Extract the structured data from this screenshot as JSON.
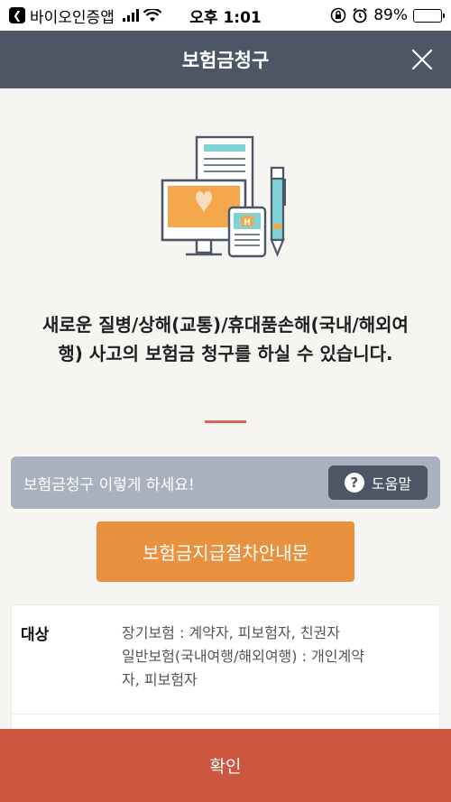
{
  "status_bar": {
    "back_app": "바이오인증앱",
    "time": "오후 1:01",
    "battery": "89%",
    "battery_level": 0.89
  },
  "header": {
    "title": "보험금청구",
    "close_icon": "close-icon"
  },
  "intro": {
    "message": "새로운 질병/상해(교통)/휴대품손해(국내/해외여행) 사고의 보험금 청구를 하실 수 있습니다."
  },
  "guide": {
    "text": "보험금청구 이렇게 하세요!",
    "help_label": "도움말",
    "help_icon": "question-icon"
  },
  "procedure_button": {
    "label": "보험금지급절차안내문"
  },
  "info": {
    "label": "대상",
    "lines": [
      "장기보험 : 계약자, 피보험자, 친권자",
      "일반보험(국내여행/해외여행) : 개인계약",
      "자, 피보험자"
    ]
  },
  "confirm_button": {
    "label": "확인"
  },
  "colors": {
    "header_bg": "#4c5664",
    "accent_orange": "#e8913e",
    "confirm_red": "#cc5640",
    "guide_bg": "#a9b1bf"
  }
}
